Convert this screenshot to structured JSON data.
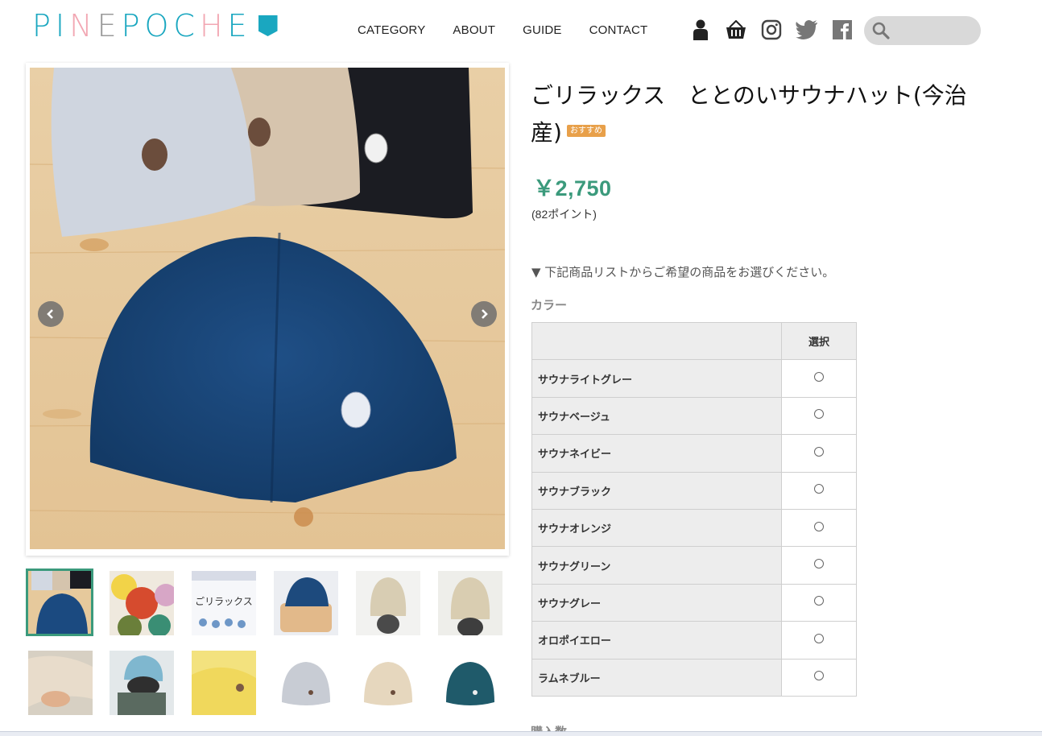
{
  "brand": {
    "logo_part1": "PI",
    "logo_part2": "N",
    "logo_part3": "E ",
    "logo_part4": "POC",
    "logo_part5": "H",
    "logo_part6": "E",
    "accent": "#1aa7c0",
    "pink": "#f2a7b3"
  },
  "nav": [
    "CATEGORY",
    "ABOUT",
    "GUIDE",
    "CONTACT"
  ],
  "header_icons": [
    "user-icon",
    "basket-icon",
    "instagram-icon",
    "twitter-icon",
    "facebook-icon"
  ],
  "search": {
    "placeholder": "",
    "icon": "search-icon"
  },
  "product": {
    "title": "ごリラックス　ととのいサウナハット(今治産)",
    "badge": "おすすめ",
    "price": "￥2,750",
    "points": "(82ポイント)",
    "instruction": "▼ 下記商品リストからご希望の商品をお選びください。",
    "color_label": "カラー",
    "select_header": "選択",
    "options": [
      "サウナライトグレー",
      "サウナベージュ",
      "サウナネイビー",
      "サウナブラック",
      "サウナオレンジ",
      "サウナグリーン",
      "サウナグレー",
      "オロポイエロー",
      "ラムネブルー"
    ],
    "qty_label": "購入数",
    "price_color": "#3b9a7c"
  },
  "gallery": {
    "thumb_count": 12,
    "selected_index": 0,
    "thumb_logo_text": "ごリラックス"
  }
}
